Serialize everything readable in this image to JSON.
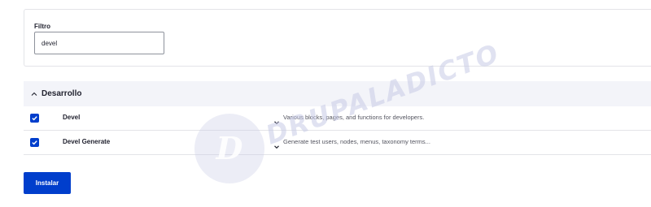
{
  "filter": {
    "label": "Filtro",
    "value": "devel"
  },
  "section": {
    "title": "Desarrollo",
    "icon": "chevron-up-icon"
  },
  "modules": [
    {
      "name": "Devel",
      "checked": true,
      "description": "Various blocks, pages, and functions for developers."
    },
    {
      "name": "Devel Generate",
      "checked": true,
      "description": "Generate test users, nodes, menus, taxonomy terms..."
    }
  ],
  "actions": {
    "install_label": "Instalar"
  },
  "watermark": {
    "text": "DRUPALADICTO",
    "logo_letter": "D"
  },
  "colors": {
    "primary": "#003ecc",
    "section_bg": "#f3f4f9",
    "border": "#e3e4e8",
    "watermark": "#c8cbe6"
  }
}
